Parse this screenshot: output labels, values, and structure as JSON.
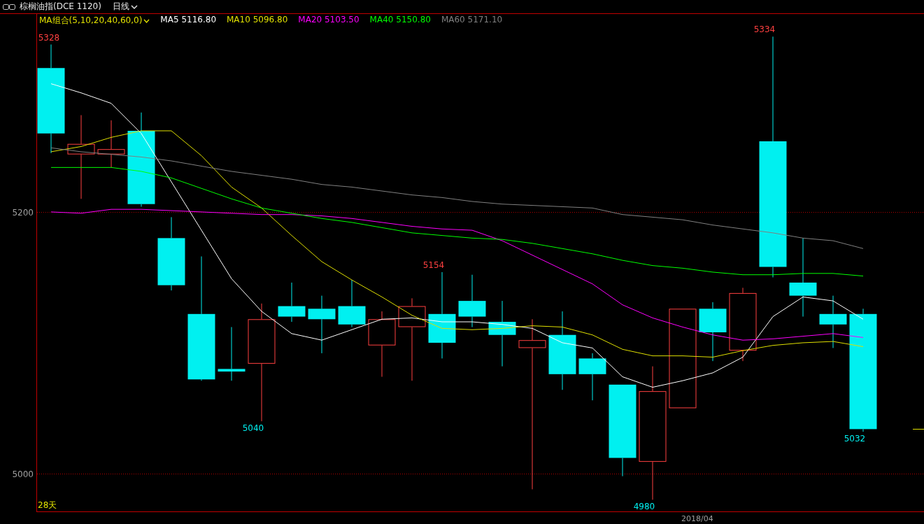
{
  "header": {
    "title": "棕榈油指(DCE 1120)",
    "period": "日线"
  },
  "legend": {
    "group": "MA组合(5,10,20,40,60,0)",
    "values": [
      "5116.80",
      "5096.80",
      "5103.50",
      "5150.80",
      "5171.10"
    ]
  },
  "chart": {
    "day_count": "28天",
    "date_label": "2018/04",
    "chart_data": {
      "type": "line",
      "yticks": [
        {
          "value": 5000,
          "label": "5000"
        },
        {
          "value": 5200,
          "label": "5200"
        }
      ],
      "ylim": [
        4971.1,
        5351.3
      ],
      "series": [
        {
          "name": "MA5",
          "color": "#ffffff",
          "values": [
            5298,
            5291,
            5283,
            5260,
            5223,
            5186,
            5149,
            5124,
            5107,
            5102,
            5110,
            5118,
            5119,
            5116,
            5116,
            5114,
            5111,
            5100,
            5096,
            5074,
            5066,
            5071,
            5077,
            5089,
            5120,
            5135,
            5132,
            5118
          ]
        },
        {
          "name": "MA10",
          "color": "#e0e000",
          "values": [
            5246,
            5250,
            5257,
            5262,
            5262,
            5243,
            5219,
            5203,
            5182,
            5162,
            5148,
            5135,
            5121,
            5111,
            5110,
            5111,
            5113,
            5112,
            5106,
            5095,
            5090,
            5090,
            5089,
            5094,
            5098,
            5100,
            5101,
            5097
          ]
        },
        {
          "name": "MA20",
          "color": "#ff00ff",
          "values": [
            5200,
            5199,
            5202,
            5202,
            5201,
            5200,
            5199,
            5198,
            5198,
            5197,
            5195,
            5192,
            5189,
            5187,
            5186,
            5178,
            5167,
            5156,
            5145,
            5129,
            5119,
            5112,
            5106,
            5102,
            5103,
            5105,
            5107,
            5104
          ]
        },
        {
          "name": "MA40",
          "color": "#00ff00",
          "values": [
            5234,
            5234,
            5234,
            5231,
            5226,
            5218,
            5210,
            5203,
            5199,
            5195,
            5192,
            5188,
            5184,
            5182,
            5180,
            5179,
            5176,
            5172,
            5168,
            5163,
            5159,
            5157,
            5154,
            5152,
            5152,
            5153,
            5153,
            5151
          ]
        },
        {
          "name": "MA60",
          "color": "#808080",
          "values": [
            5249,
            5246,
            5244,
            5242,
            5239,
            5235,
            5231,
            5228,
            5225,
            5221,
            5219,
            5216,
            5213,
            5211,
            5208,
            5206,
            5205,
            5204,
            5203,
            5198,
            5196,
            5194,
            5190,
            5187,
            5184,
            5180,
            5178,
            5172
          ]
        }
      ],
      "annotations": [
        "5328",
        "5040",
        "5154",
        "4980",
        "5334",
        "5032"
      ]
    }
  }
}
